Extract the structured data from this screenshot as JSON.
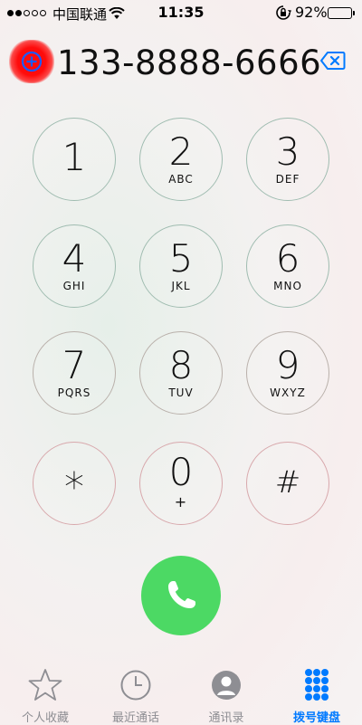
{
  "status_bar": {
    "carrier": "中国联通",
    "time": "11:35",
    "battery_percent": "92%",
    "battery_level": 0.92,
    "signal_bars_filled": 2,
    "signal_bars_total": 5
  },
  "dialer": {
    "number": "133-8888-6666",
    "add_contact_icon": "plus-circle-icon",
    "delete_icon": "backspace-icon"
  },
  "keypad": [
    {
      "digit": "1",
      "letters": ""
    },
    {
      "digit": "2",
      "letters": "ABC"
    },
    {
      "digit": "3",
      "letters": "DEF"
    },
    {
      "digit": "4",
      "letters": "GHI"
    },
    {
      "digit": "5",
      "letters": "JKL"
    },
    {
      "digit": "6",
      "letters": "MNO"
    },
    {
      "digit": "7",
      "letters": "PQRS"
    },
    {
      "digit": "8",
      "letters": "TUV"
    },
    {
      "digit": "9",
      "letters": "WXYZ"
    },
    {
      "digit": "*",
      "letters": ""
    },
    {
      "digit": "0",
      "letters": "+"
    },
    {
      "digit": "#",
      "letters": ""
    }
  ],
  "call_button": {
    "icon": "phone-icon",
    "color": "#4cd964"
  },
  "tabs": [
    {
      "label": "个人收藏",
      "icon": "star-icon",
      "active": false
    },
    {
      "label": "最近通话",
      "icon": "clock-icon",
      "active": false
    },
    {
      "label": "通讯录",
      "icon": "contacts-icon",
      "active": false
    },
    {
      "label": "拨号键盘",
      "icon": "keypad-icon",
      "active": true
    }
  ],
  "colors": {
    "accent": "#007aff",
    "highlight": "#ff0000",
    "inactive": "#8e8e93"
  }
}
